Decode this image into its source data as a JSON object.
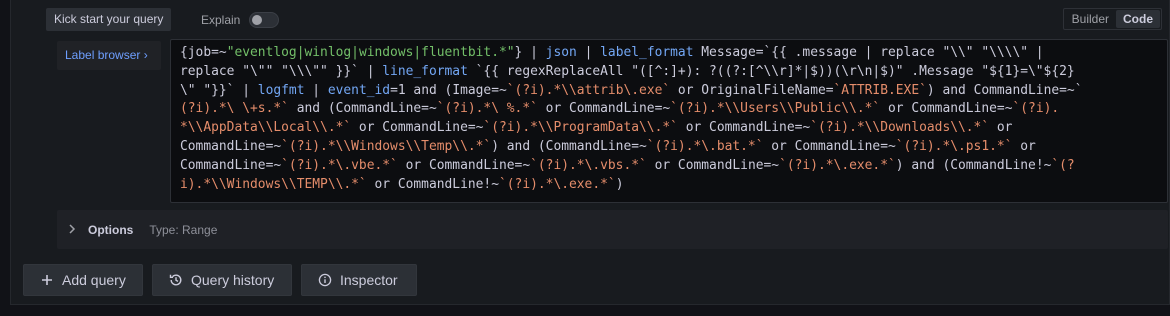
{
  "toolbar": {
    "kick_start_label": "Kick start your query",
    "explain_label": "Explain",
    "explain_enabled": false,
    "modes": [
      "Builder",
      "Code"
    ],
    "active_mode": "Code"
  },
  "editor": {
    "label_browser": "Label browser ›",
    "lines": [
      [
        [
          "",
          "{job=~"
        ],
        [
          "c-g",
          "\"eventlog|winlog|windows|fluentbit.*\""
        ],
        [
          "",
          "} | "
        ],
        [
          "c-b",
          "json"
        ],
        [
          "",
          " | "
        ],
        [
          "c-b",
          "label_format"
        ],
        [
          "",
          " Message=`{{ .message | replace \"\\\\\" \"\\\\\\\\\" |"
        ]
      ],
      [
        [
          "",
          "replace \"\\\"\" \"\\\\\\\"\" }}` | "
        ],
        [
          "c-b",
          "line_format"
        ],
        [
          "",
          " `{{ regexReplaceAll \"([^:]+): ?((?:[^\\\\r]*|$))(\\r\\n|$)\" .Message \"${1}=\\\"${2}"
        ]
      ],
      [
        [
          "",
          "\\\" \"}}` | "
        ],
        [
          "c-b",
          "logfmt"
        ],
        [
          "",
          " | "
        ],
        [
          "c-b",
          "event_id"
        ],
        [
          "",
          "=1 and (Image=~"
        ],
        [
          "c-o",
          "`(?i).*\\\\attrib\\.exe`"
        ],
        [
          "",
          " or OriginalFileName="
        ],
        [
          "c-o",
          "`ATTRIB.EXE`"
        ],
        [
          "",
          ") and CommandLine=~`"
        ]
      ],
      [
        [
          "c-o",
          "(?i).*\\ \\+s.*`"
        ],
        [
          "",
          " and (CommandLine=~"
        ],
        [
          "c-o",
          "`(?i).*\\ %.*`"
        ],
        [
          "",
          " or CommandLine=~"
        ],
        [
          "c-o",
          "`(?i).*\\\\Users\\\\Public\\\\.*`"
        ],
        [
          "",
          " or CommandLine=~"
        ],
        [
          "c-o",
          "`(?i)."
        ]
      ],
      [
        [
          "c-o",
          "*\\\\AppData\\\\Local\\\\.*`"
        ],
        [
          "",
          " or CommandLine=~"
        ],
        [
          "c-o",
          "`(?i).*\\\\ProgramData\\\\.*`"
        ],
        [
          "",
          " or CommandLine=~"
        ],
        [
          "c-o",
          "`(?i).*\\\\Downloads\\\\.*`"
        ],
        [
          "",
          " or"
        ]
      ],
      [
        [
          "",
          "CommandLine=~"
        ],
        [
          "c-o",
          "`(?i).*\\\\Windows\\\\Temp\\\\.*`"
        ],
        [
          "",
          ") and (CommandLine=~"
        ],
        [
          "c-o",
          "`(?i).*\\.bat.*`"
        ],
        [
          "",
          " or CommandLine=~"
        ],
        [
          "c-o",
          "`(?i).*\\.ps1.*`"
        ],
        [
          "",
          " or"
        ]
      ],
      [
        [
          "",
          "CommandLine=~"
        ],
        [
          "c-o",
          "`(?i).*\\.vbe.*`"
        ],
        [
          "",
          " or CommandLine=~"
        ],
        [
          "c-o",
          "`(?i).*\\.vbs.*`"
        ],
        [
          "",
          " or CommandLine=~"
        ],
        [
          "c-o",
          "`(?i).*\\.exe.*`"
        ],
        [
          "",
          ") and (CommandLine!~"
        ],
        [
          "c-o",
          "`(?"
        ]
      ],
      [
        [
          "c-o",
          "i).*\\\\Windows\\\\TEMP\\\\.*`"
        ],
        [
          "",
          " or CommandLine!~"
        ],
        [
          "c-o",
          "`(?i).*\\.exe.*`"
        ],
        [
          "",
          ")"
        ]
      ]
    ]
  },
  "options": {
    "label": "Options",
    "type_text": "Type: Range"
  },
  "actions": {
    "add_query": "Add query",
    "query_history": "Query history",
    "inspector": "Inspector"
  },
  "icons": {
    "options_chevron": "chevron-right-icon",
    "add": "plus-icon",
    "history": "history-icon",
    "inspector": "info-circle-icon"
  },
  "colors": {
    "background": "#111217",
    "panel": "#181b1f",
    "editor_bg": "#0c0d10",
    "string": "#73bf69",
    "backtick_string": "#e58d6b",
    "function": "#73a7f5",
    "link": "#6e9fff"
  }
}
